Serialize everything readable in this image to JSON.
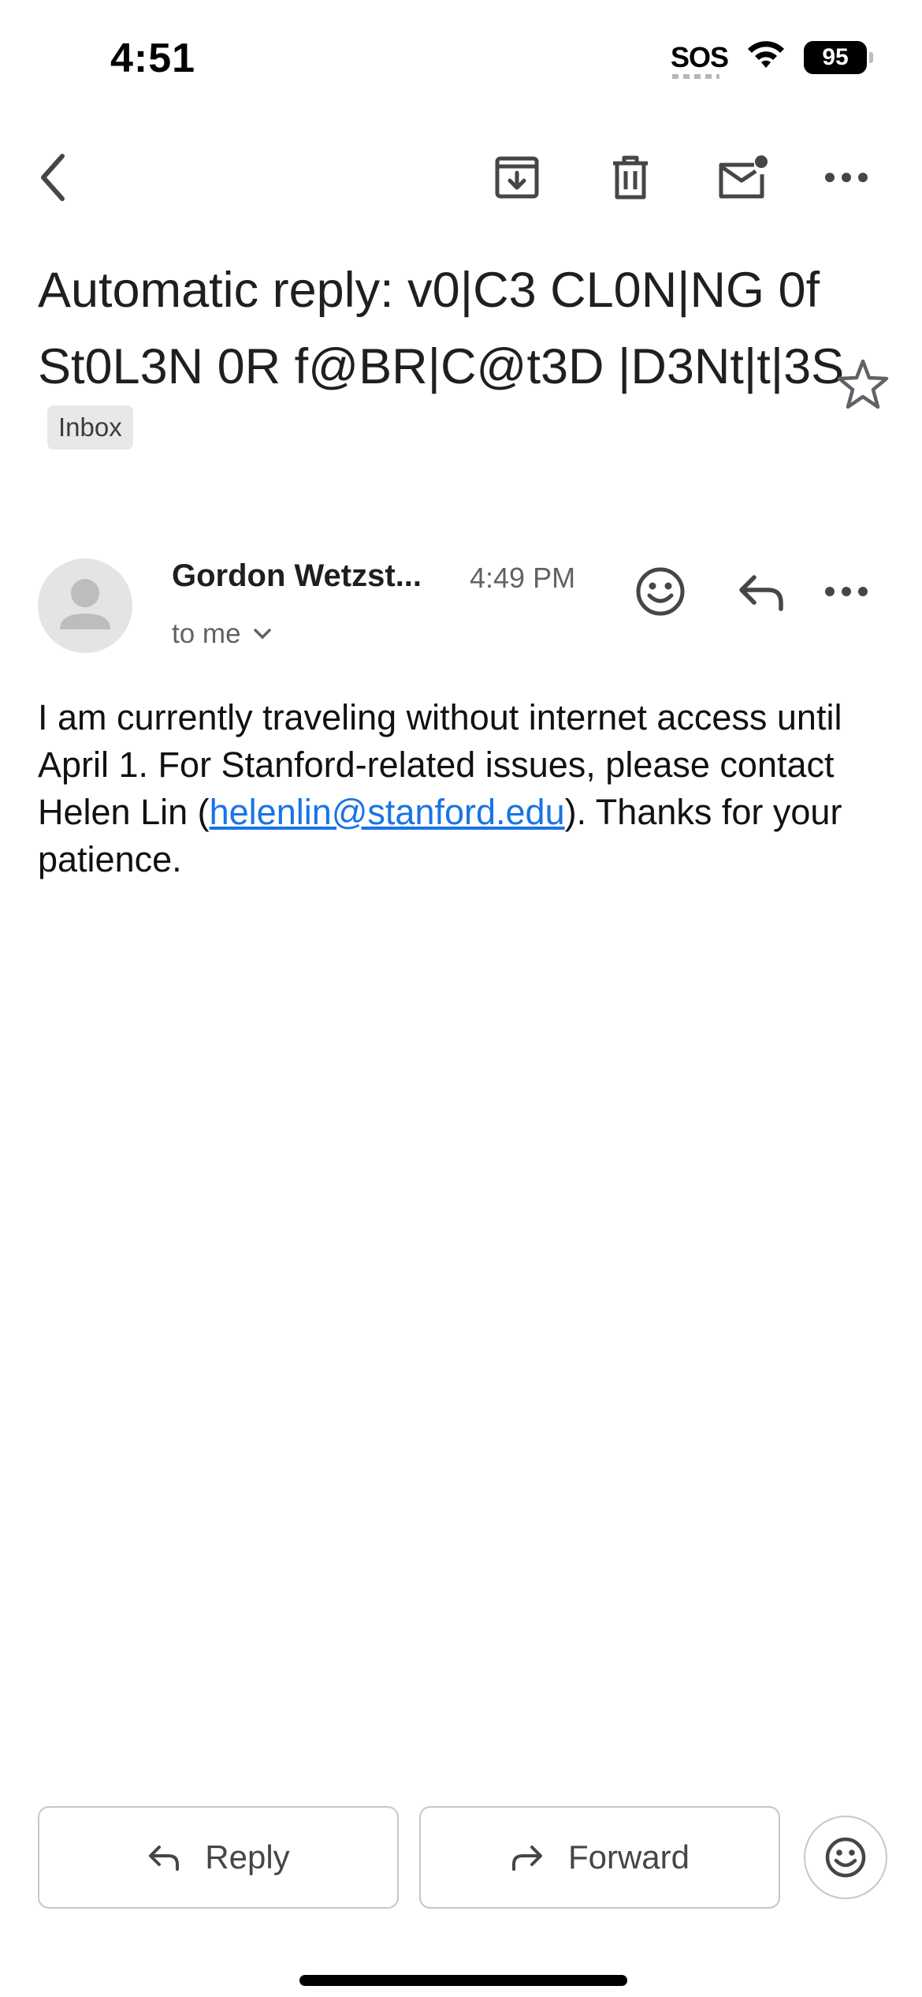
{
  "status_bar": {
    "time": "4:51",
    "sos": "SOS",
    "battery": "95"
  },
  "toolbar": {
    "icons": [
      "back-arrow-icon",
      "archive-icon",
      "trash-icon",
      "mark-unread-icon",
      "more-icon"
    ]
  },
  "email": {
    "subject": "Automatic reply: v0|C3 CL0N|NG 0f St0L3N 0R f@BR|C@t3D |D3Nt|t|3S",
    "label": "Inbox",
    "starred": false,
    "sender": "Gordon Wetzst...",
    "time": "4:49 PM",
    "recipient": "to me",
    "body": {
      "part1": "I am currently traveling without internet access until April 1. For Stanford-related issues, please contact Helen Lin (",
      "link": "helenlin@stanford.edu",
      "part2": "). Thanks for your patience."
    }
  },
  "actions": {
    "reply": "Reply",
    "forward": "Forward"
  },
  "colors": {
    "link": "#1a73e8",
    "chip_bg": "#e8e8e8",
    "icon": "#444746"
  }
}
